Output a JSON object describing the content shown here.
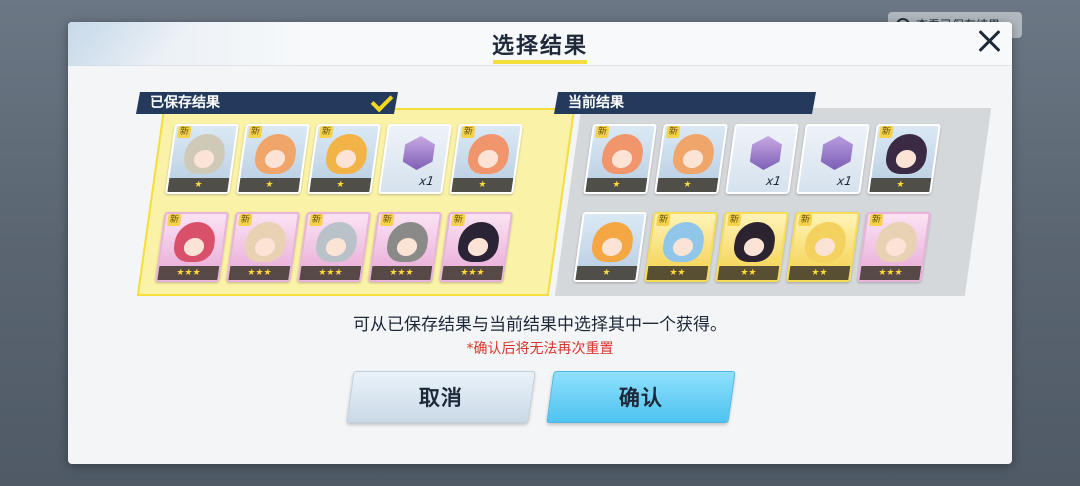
{
  "background": {
    "chip_text": "查看已保存结果"
  },
  "dialog": {
    "title": "选择结果",
    "instruction": "可从已保存结果与当前结果中选择其中一个获得。",
    "warning": "*确认后将无法再次重置",
    "cancel_label": "取消",
    "confirm_label": "确认"
  },
  "saved": {
    "label": "已保存结果",
    "cards": [
      {
        "new": "新",
        "stars": "★",
        "rarity": "r1",
        "hair": "#cfc9b8"
      },
      {
        "new": "新",
        "stars": "★",
        "rarity": "r1",
        "hair": "#f0a56a"
      },
      {
        "new": "新",
        "stars": "★",
        "rarity": "r1",
        "hair": "#f2b347"
      },
      {
        "new": "",
        "stars": "",
        "rarity": "item",
        "gem": "#c9a8e4",
        "count": "x1"
      },
      {
        "new": "新",
        "stars": "★",
        "rarity": "r1",
        "hair": "#f0956c"
      },
      {
        "new": "新",
        "stars": "★★★",
        "rarity": "r3",
        "hair": "#d9506a"
      },
      {
        "new": "新",
        "stars": "★★★",
        "rarity": "r3",
        "hair": "#e8d2b3"
      },
      {
        "new": "新",
        "stars": "★★★",
        "rarity": "r3",
        "hair": "#b9c2c8"
      },
      {
        "new": "新",
        "stars": "★★★",
        "rarity": "r3",
        "hair": "#8a8a88"
      },
      {
        "new": "新",
        "stars": "★★★",
        "rarity": "r3",
        "hair": "#2a2436"
      }
    ]
  },
  "current": {
    "label": "当前结果",
    "cards": [
      {
        "new": "新",
        "stars": "★",
        "rarity": "r1",
        "hair": "#f0956c"
      },
      {
        "new": "新",
        "stars": "★",
        "rarity": "r1",
        "hair": "#f0a56a"
      },
      {
        "new": "",
        "stars": "",
        "rarity": "item",
        "gem": "#c9a8e4",
        "count": "x1"
      },
      {
        "new": "",
        "stars": "",
        "rarity": "item",
        "gem": "#b79be0",
        "count": "x1"
      },
      {
        "new": "新",
        "stars": "★",
        "rarity": "r1",
        "hair": "#3a2a44"
      },
      {
        "new": "",
        "stars": "★",
        "rarity": "r1",
        "hair": "#f4a742"
      },
      {
        "new": "新",
        "stars": "★★",
        "rarity": "r2",
        "hair": "#8fc6ea"
      },
      {
        "new": "新",
        "stars": "★★",
        "rarity": "r2",
        "hair": "#2b2430"
      },
      {
        "new": "新",
        "stars": "★★",
        "rarity": "r2",
        "hair": "#f3d260"
      },
      {
        "new": "新",
        "stars": "★★★",
        "rarity": "r3",
        "hair": "#e8d2b3"
      }
    ]
  }
}
